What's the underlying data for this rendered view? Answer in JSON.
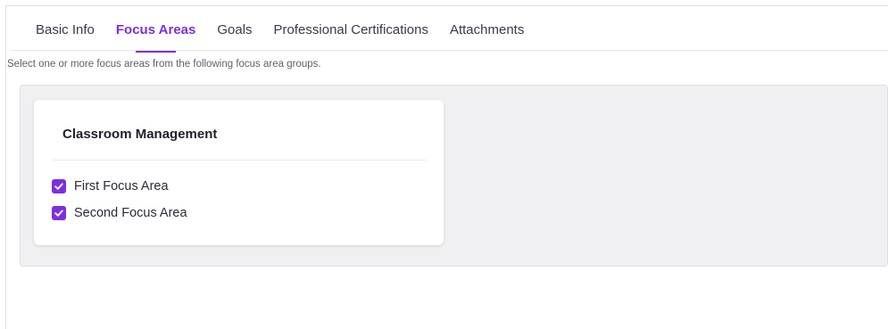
{
  "tabs": [
    {
      "label": "Basic Info",
      "active": false
    },
    {
      "label": "Focus Areas",
      "active": true
    },
    {
      "label": "Goals",
      "active": false
    },
    {
      "label": "Professional Certifications",
      "active": false
    },
    {
      "label": "Attachments",
      "active": false
    }
  ],
  "instruction": "Select one or more focus areas from the following focus area groups.",
  "focus_group": {
    "title": "Classroom Management",
    "options": [
      {
        "label": "First Focus Area",
        "checked": true
      },
      {
        "label": "Second Focus Area",
        "checked": true
      }
    ]
  },
  "colors": {
    "accent": "#7c2fe0",
    "panel_background": "#f0f0f2"
  },
  "icons": {
    "checkbox_checked": "checkmark-icon"
  }
}
